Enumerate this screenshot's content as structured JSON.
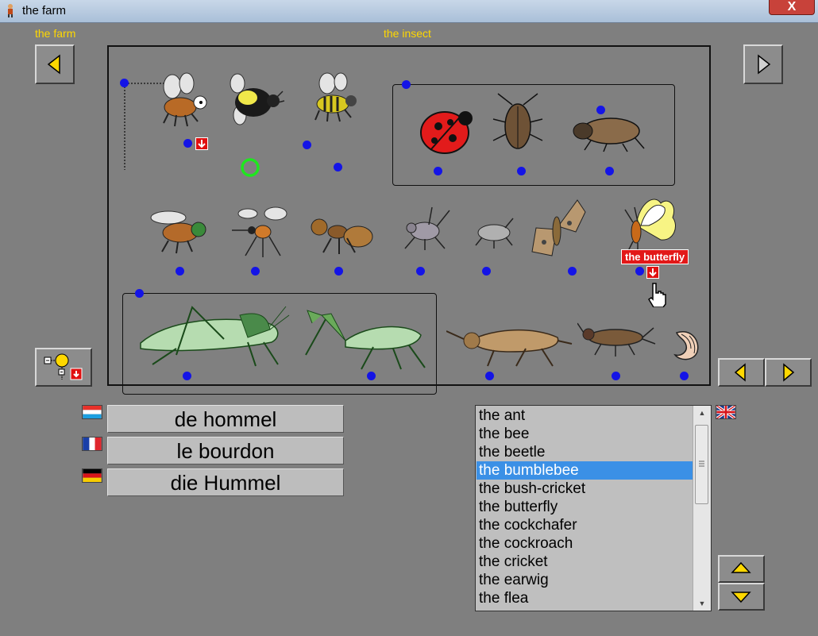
{
  "window": {
    "title": "the farm",
    "close_label": "X"
  },
  "nav": {
    "back_label": "the farm",
    "category_label": "the insect"
  },
  "tooltip": {
    "text": "the butterfly"
  },
  "translations": [
    {
      "flag": "luxembourg-flag",
      "word": "de hommel"
    },
    {
      "flag": "france-flag",
      "word": "le bourdon"
    },
    {
      "flag": "germany-flag",
      "word": "die Hummel"
    }
  ],
  "word_list": {
    "items": [
      "the ant",
      "the bee",
      "the beetle",
      "the bumblebee",
      "the bush-cricket",
      "the butterfly",
      "the cockchafer",
      "the cockroach",
      "the cricket",
      "the earwig",
      "the flea"
    ],
    "selected": "the bumblebee",
    "flag": "uk-flag"
  },
  "colors": {
    "accent_yellow": "#ffd800",
    "selection_blue": "#3b90e6",
    "marker_blue": "#1414e6",
    "badge_red": "#e01010"
  }
}
